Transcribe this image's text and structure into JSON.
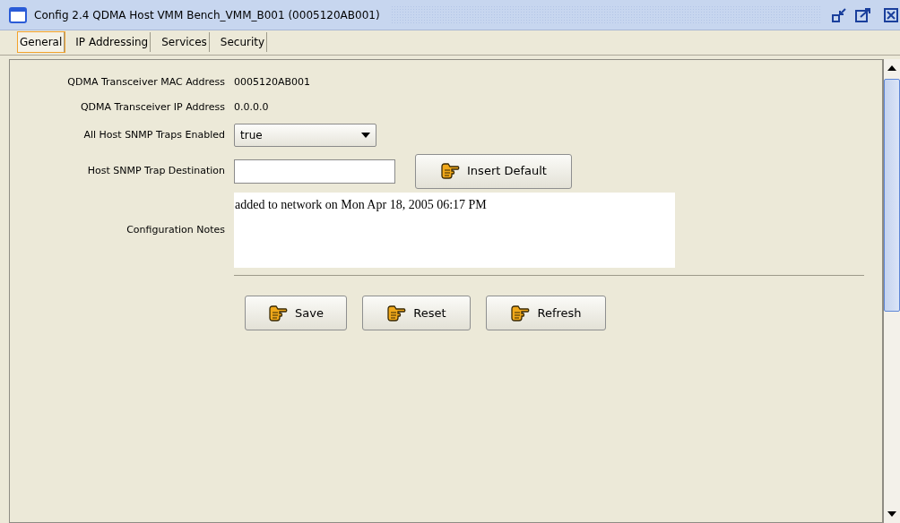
{
  "window": {
    "title": "Config 2.4 QDMA Host VMM Bench_VMM_B001 (0005120AB001)"
  },
  "tabs": [
    {
      "label": "General",
      "selected": true
    },
    {
      "label": "IP Addressing",
      "selected": false
    },
    {
      "label": "Services",
      "selected": false
    },
    {
      "label": "Security",
      "selected": false
    }
  ],
  "fields": [
    {
      "kind": "text",
      "label": "QDMA Transceiver MAC Address",
      "value": "0005120AB001"
    },
    {
      "kind": "text",
      "label": "QDMA Transceiver IP Address",
      "value": "0.0.0.0"
    },
    {
      "kind": "dropdown",
      "label": "All Host SNMP Traps Enabled",
      "value": "true"
    },
    {
      "kind": "input",
      "label": "Host SNMP Trap Destination",
      "button": "Insert Default"
    },
    {
      "kind": "notes",
      "label": "Configuration Notes",
      "value": "added to network on Mon Apr 18, 2005 06:17 PM"
    }
  ],
  "buttons": [
    "Save",
    "Reset",
    "Refresh"
  ]
}
